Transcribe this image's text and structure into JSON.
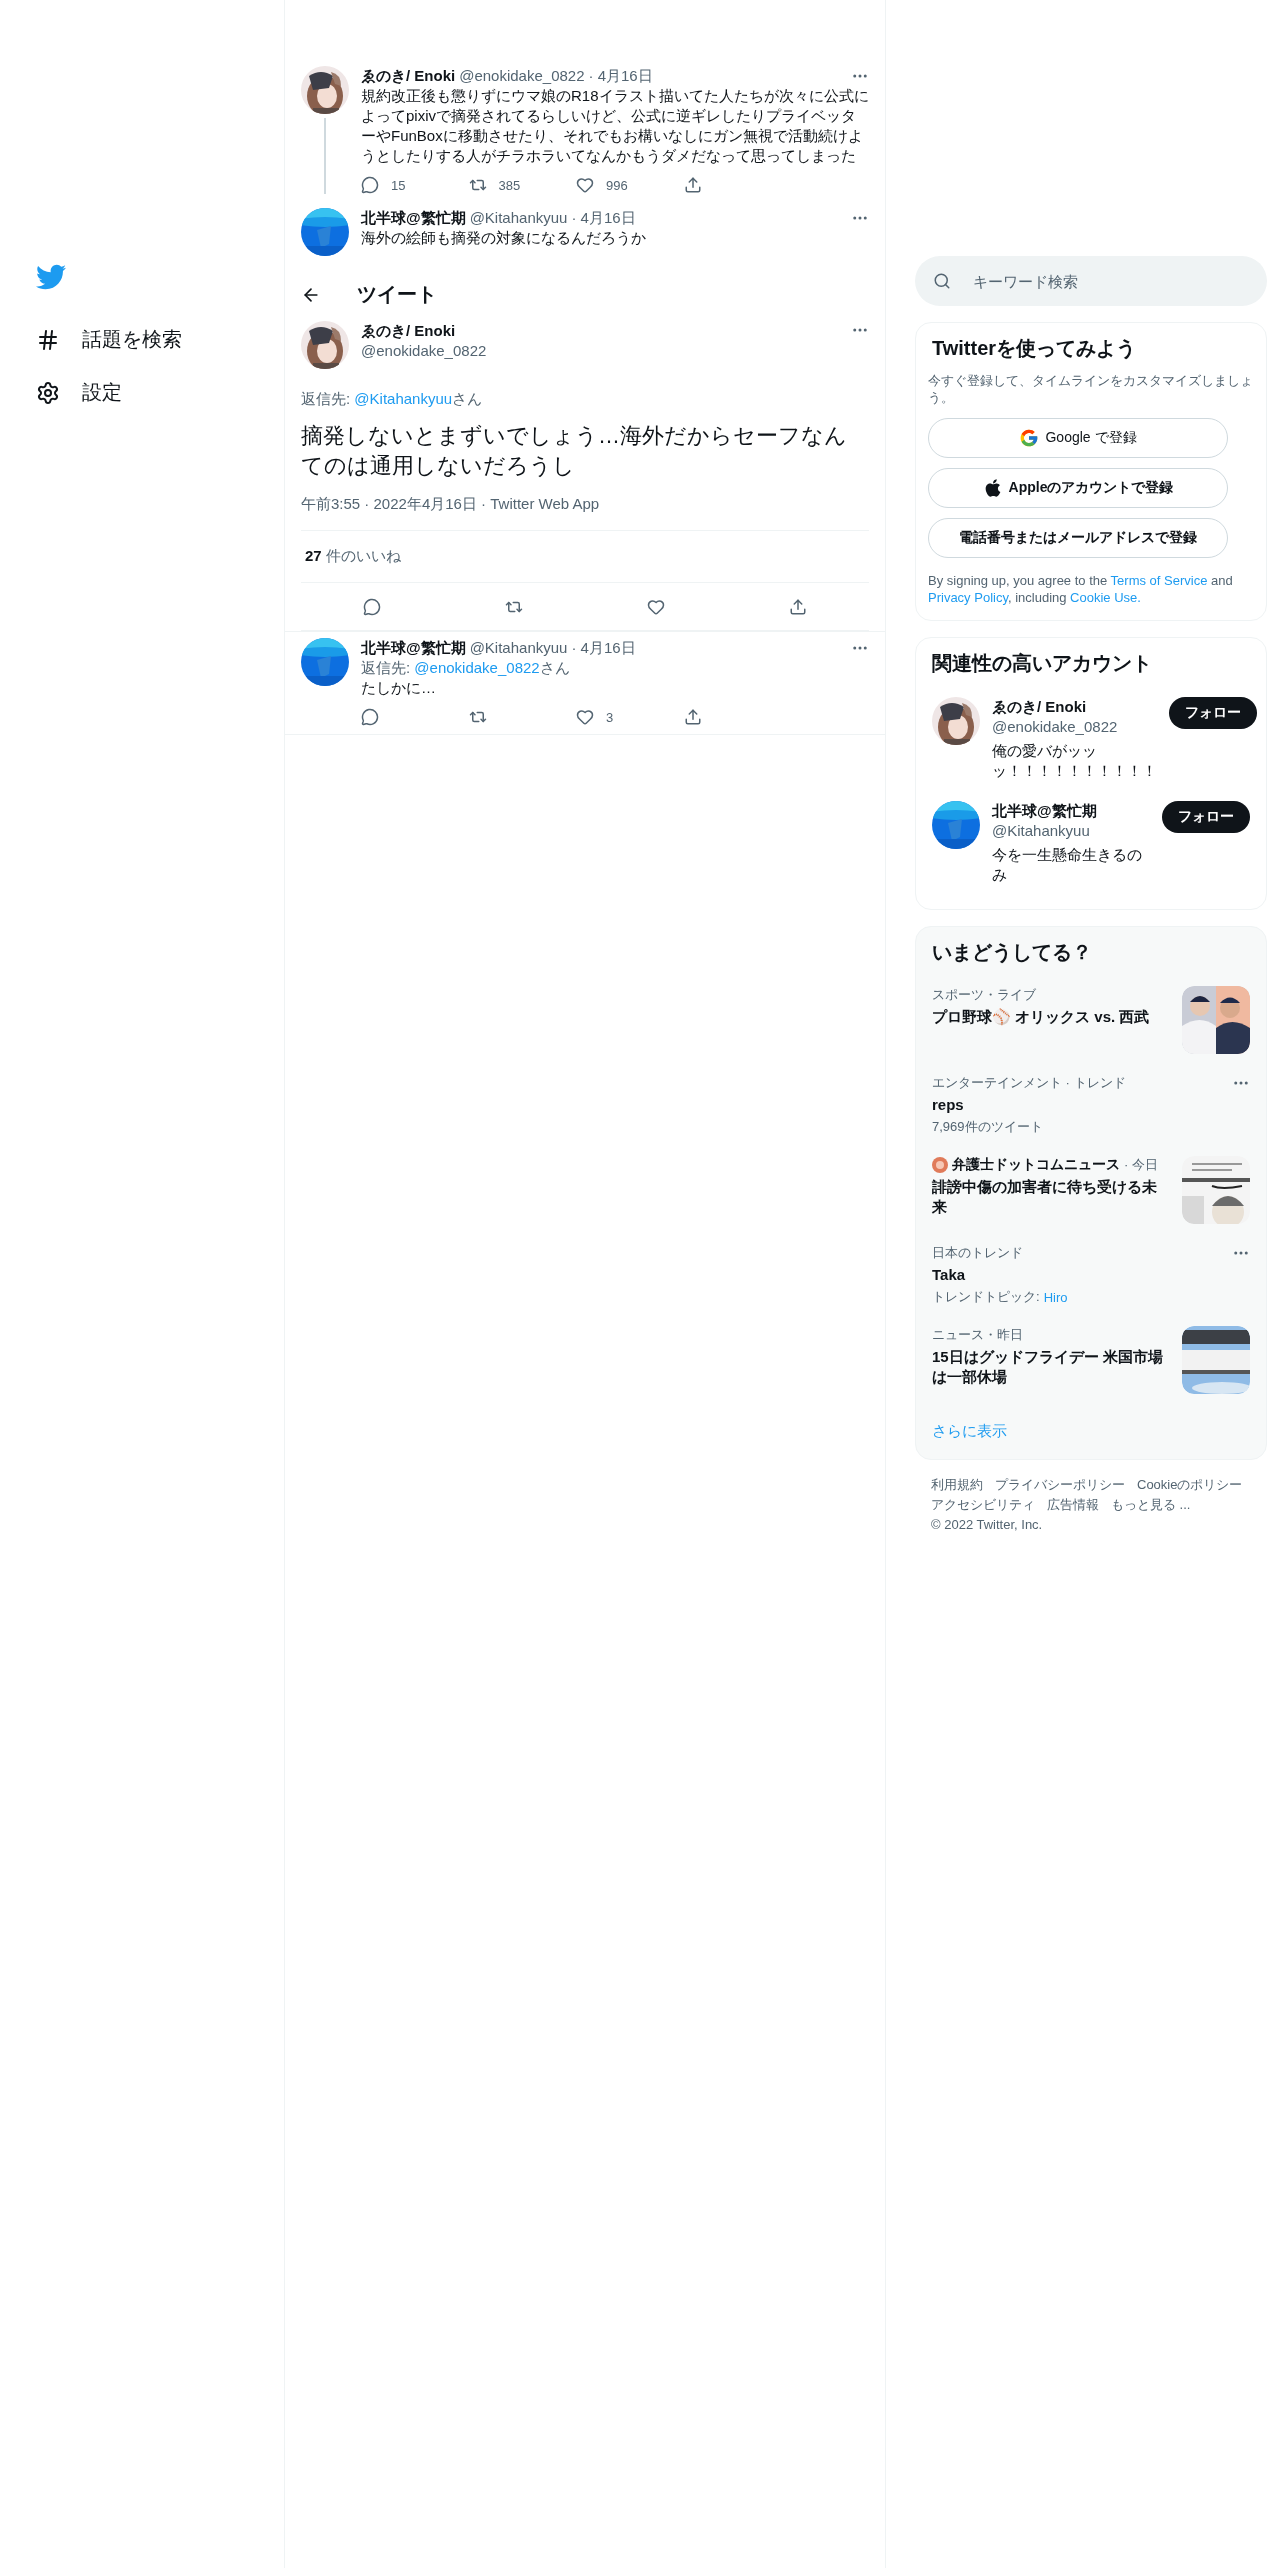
{
  "sidebar": {
    "items": [
      {
        "kind": "explore",
        "label": "話題を検索"
      },
      {
        "kind": "settings",
        "label": "設定"
      }
    ]
  },
  "thread": [
    {
      "author": "ゑのき/ Enoki",
      "handle": "@enokidake_0822",
      "date": "· 4月16日",
      "text": "規約改正後も懲りずにウマ娘のR18イラスト描いてた人たちが次々に公式によってpixivで摘発されてるらしいけど、公式に逆ギレしたりプライベッターやFunBoxに移動させたり、それでもお構いなしにガン無視で活動続けようとしたりする人がチラホラいてなんかもうダメだなって思ってしまった",
      "actions": [
        {
          "kind": "reply",
          "count": "15"
        },
        {
          "kind": "retweet",
          "count": "385"
        },
        {
          "kind": "like",
          "count": "996"
        },
        {
          "kind": "share"
        }
      ]
    },
    {
      "author": "北半球@繁忙期",
      "handle": "@Kitahankyuu",
      "date": "· 4月16日",
      "text": "海外の絵師も摘発の対象になるんだろうか"
    }
  ],
  "header": {
    "title": "ツイート"
  },
  "main_tweet": {
    "author": "ゑのき/ Enoki",
    "handle": "@enokidake_0822",
    "reply_label": "返信先:",
    "reply_to": "@Kitahankyuu",
    "reply_suffix": "さん",
    "text": "摘発しないとまずいでしょう…海外だからセーフなんてのは通用しないだろうし",
    "timestamp": "午前3:55 · 2022年4月16日 · Twitter Web App",
    "like_count": "27",
    "like_label": "件のいいね",
    "actions": [
      {
        "kind": "reply"
      },
      {
        "kind": "retweet"
      },
      {
        "kind": "like"
      },
      {
        "kind": "share"
      }
    ]
  },
  "replies": [
    {
      "author": "北半球@繁忙期",
      "handle": "@Kitahankyuu",
      "date": "· 4月16日",
      "reply_label": "返信先:",
      "reply_to": "@enokidake_0822",
      "reply_suffix": "さん",
      "text": "たしかに…",
      "actions": [
        {
          "kind": "reply"
        },
        {
          "kind": "retweet"
        },
        {
          "kind": "like",
          "count": "3"
        },
        {
          "kind": "share"
        }
      ]
    }
  ],
  "search": {
    "placeholder": "キーワード検索"
  },
  "signup": {
    "title": "Twitterを使ってみよう",
    "subtitle": "今すぐ登録して、タイムラインをカスタマイズしましょう。",
    "buttons": [
      {
        "kind": "google",
        "label": "Google で登録"
      },
      {
        "kind": "apple",
        "label": "Appleのアカウントで登録"
      },
      {
        "kind": "plain",
        "label": "電話番号またはメールアドレスで登録"
      }
    ],
    "legal": [
      {
        "text": "By signing up, you agree to the ",
        "link": false
      },
      {
        "text": "Terms of Service",
        "link": true
      },
      {
        "text": " and ",
        "link": false
      },
      {
        "text": "Privacy Policy",
        "link": true
      },
      {
        "text": ", including ",
        "link": false
      },
      {
        "text": "Cookie Use.",
        "link": true
      }
    ]
  },
  "accounts": {
    "title": "関連性の高いアカウント",
    "items": [
      {
        "name": "ゑのき/ Enoki",
        "handle": "@enokidake_0822",
        "bio": "俺の愛バがッッッ！！！！！！！！！！",
        "button": "フォロー"
      },
      {
        "name": "北半球@繁忙期",
        "handle": "@Kitahankyuu",
        "bio": "今を一生懸命生きるのみ",
        "button": "フォロー"
      }
    ]
  },
  "trends": {
    "title": "いまどうしてる？",
    "items": [
      {
        "kind": "news",
        "category": "スポーツ・ライブ",
        "title": "プロ野球⚾ オリックス vs. 西武"
      },
      {
        "kind": "trend",
        "category": "エンターテインメント · トレンド",
        "title": "reps",
        "meta": "7,969件のツイート"
      },
      {
        "kind": "news",
        "source": "弁護士ドットコムニュース",
        "category": "· 今日",
        "title": "誹謗中傷の加害者に待ち受ける未来"
      },
      {
        "kind": "trend",
        "category": "日本のトレンド",
        "title": "Taka",
        "meta": "トレンドトピック:",
        "meta_link": "Hiro"
      },
      {
        "kind": "news",
        "category": "ニュース・昨日",
        "title": "15日はグッドフライデー 米国市場は一部休場"
      }
    ],
    "more": "さらに表示"
  },
  "footer": {
    "links": [
      "利用規約",
      "プライバシーポリシー",
      "Cookieのポリシー",
      "アクセシビリティ",
      "広告情報",
      "もっと見る ..."
    ],
    "copyright": "© 2022 Twitter, Inc."
  }
}
